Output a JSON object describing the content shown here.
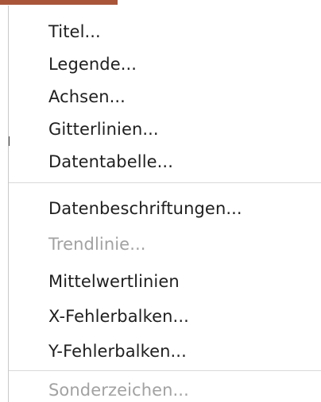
{
  "theme": {
    "accent": "#a9553a",
    "text": "#1f1f1f",
    "disabled_text": "#a2a2a2",
    "separator": "#d9d9d9"
  },
  "menu": {
    "items": [
      {
        "label": "Titel...",
        "enabled": true
      },
      {
        "label": "Legende...",
        "enabled": true
      },
      {
        "label": "Achsen...",
        "enabled": true
      },
      {
        "label": "Gitterlinien...",
        "enabled": true
      },
      {
        "label": "Datentabelle...",
        "enabled": true
      },
      {
        "label": "Datenbeschriftungen...",
        "enabled": true
      },
      {
        "label": "Trendlinie...",
        "enabled": false
      },
      {
        "label": "Mittelwertlinien",
        "enabled": true
      },
      {
        "label": "X-Fehlerbalken...",
        "enabled": true
      },
      {
        "label": "Y-Fehlerbalken...",
        "enabled": true
      },
      {
        "label": "Sonderzeichen...",
        "enabled": false
      }
    ]
  }
}
